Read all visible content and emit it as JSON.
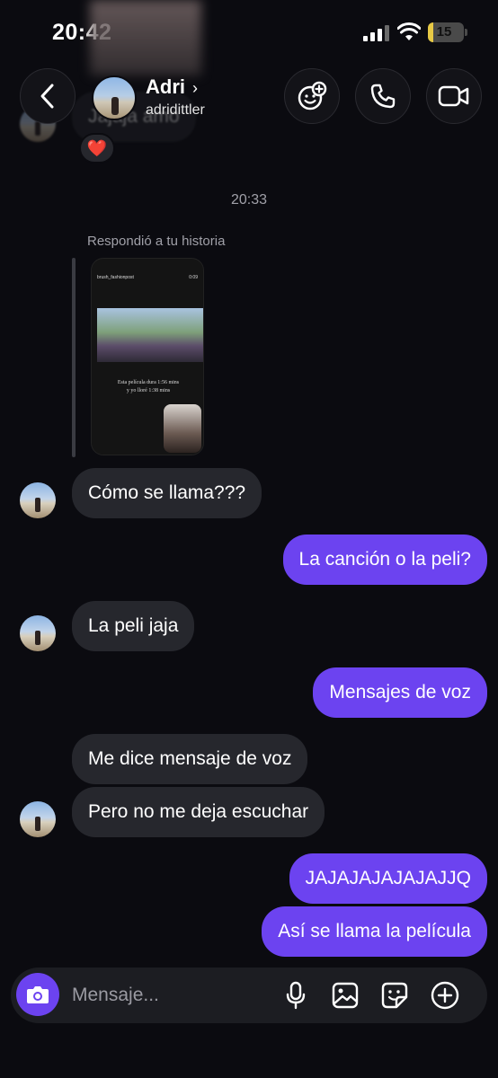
{
  "status_bar": {
    "time": "20:42",
    "battery": "15",
    "battery_level": 0.15
  },
  "header": {
    "name": "Adri",
    "username": "adridittler"
  },
  "ghost_message": {
    "text": "Jajaja amo",
    "reaction": "❤️"
  },
  "timestamp": "20:33",
  "story_reply": {
    "label": "Respondió a tu historia",
    "story_user": "brush_fashionpost",
    "story_time": "0:09",
    "caption_line1": "Esta película dura 1:56 mins",
    "caption_line2": "y yo lloré 1:38 mins"
  },
  "messages": [
    {
      "from": "them",
      "text": "Cómo se llama???"
    },
    {
      "from": "me",
      "text": "La canción o la peli?"
    },
    {
      "from": "them",
      "text": "La peli jaja"
    },
    {
      "from": "me",
      "text": "Mensajes de voz"
    },
    {
      "from": "them",
      "text": "Me dice mensaje de voz"
    },
    {
      "from": "them",
      "text": "Pero no me deja escuchar"
    },
    {
      "from": "me",
      "text": "JAJAJAJAJAJAJJQ"
    },
    {
      "from": "me",
      "text": "Así se llama la película"
    }
  ],
  "composer": {
    "placeholder": "Mensaje..."
  },
  "colors": {
    "background": "#0b0b10",
    "incoming": "#26272d",
    "outgoing": "#6c43f0"
  }
}
